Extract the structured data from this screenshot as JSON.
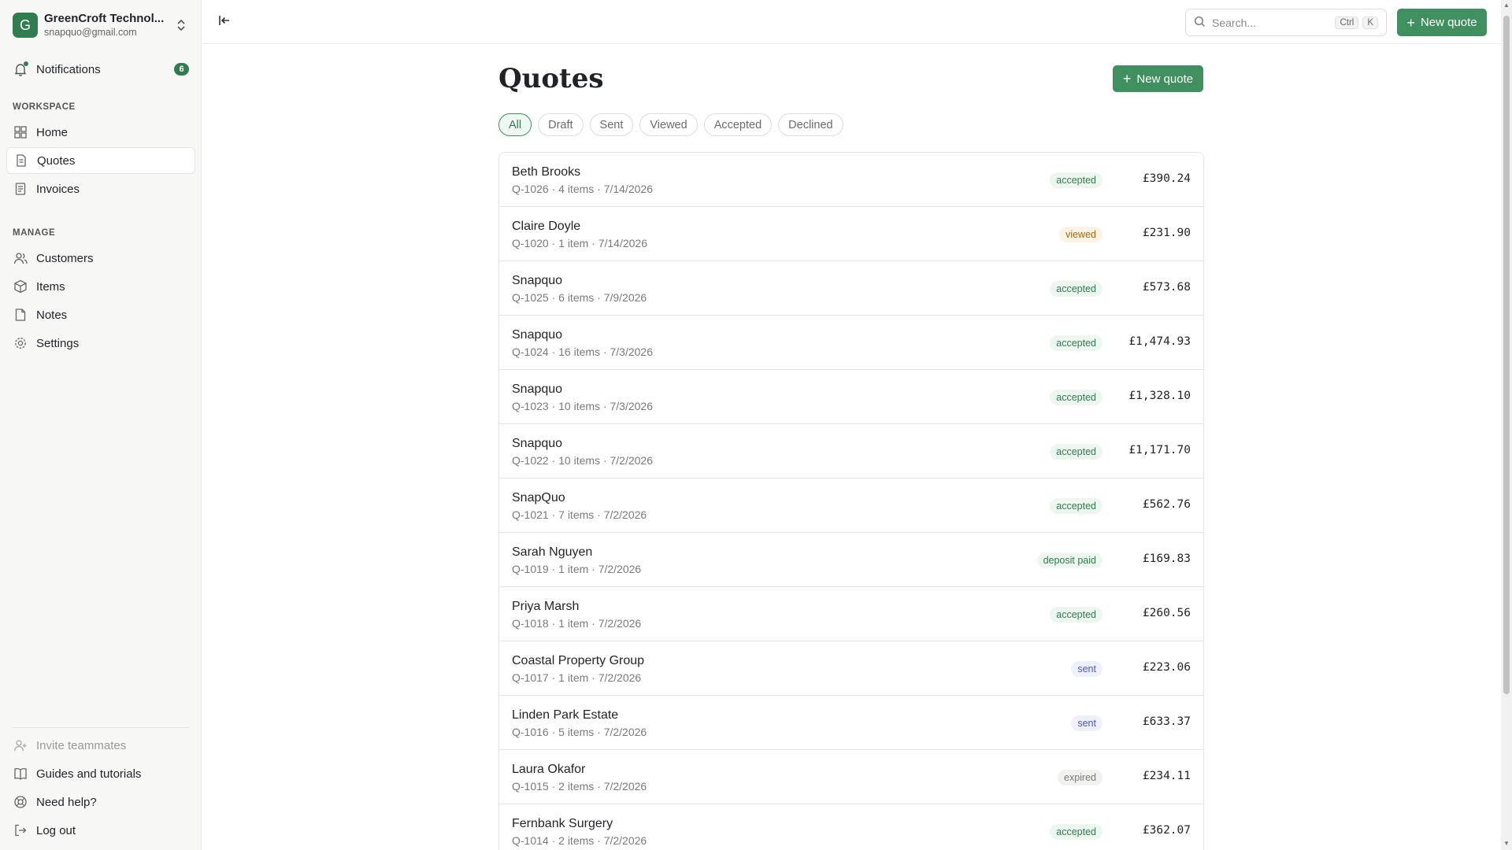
{
  "account": {
    "initial": "G",
    "name": "GreenCroft Technol...",
    "email": "snapquo@gmail.com"
  },
  "notifications": {
    "label": "Notifications",
    "count": "6"
  },
  "sidebar": {
    "workspace_label": "WORKSPACE",
    "workspace_items": [
      {
        "label": "Home",
        "icon": "grid-icon"
      },
      {
        "label": "Quotes",
        "icon": "document-icon"
      },
      {
        "label": "Invoices",
        "icon": "receipt-icon"
      }
    ],
    "manage_label": "MANAGE",
    "manage_items": [
      {
        "label": "Customers",
        "icon": "users-icon"
      },
      {
        "label": "Items",
        "icon": "box-icon"
      },
      {
        "label": "Notes",
        "icon": "note-icon"
      },
      {
        "label": "Settings",
        "icon": "gear-icon"
      }
    ],
    "bottom_items": [
      {
        "label": "Invite teammates",
        "icon": "user-plus-icon"
      },
      {
        "label": "Guides and tutorials",
        "icon": "book-icon"
      },
      {
        "label": "Need help?",
        "icon": "help-icon"
      },
      {
        "label": "Log out",
        "icon": "logout-icon"
      }
    ]
  },
  "topbar": {
    "search_placeholder": "Search...",
    "kbd_ctrl": "Ctrl",
    "kbd_k": "K",
    "new_quote_label": "New quote"
  },
  "main": {
    "title": "Quotes",
    "new_quote_label": "New quote",
    "filters": [
      "All",
      "Draft",
      "Sent",
      "Viewed",
      "Accepted",
      "Declined"
    ],
    "quotes": [
      {
        "name": "Beth Brooks",
        "meta": "Q-1026 · 4 items · 7/14/2026",
        "status": "accepted",
        "amount": "£390.24"
      },
      {
        "name": "Claire Doyle",
        "meta": "Q-1020 · 1 item · 7/14/2026",
        "status": "viewed",
        "amount": "£231.90"
      },
      {
        "name": "Snapquo",
        "meta": "Q-1025 · 6 items · 7/9/2026",
        "status": "accepted",
        "amount": "£573.68"
      },
      {
        "name": "Snapquo",
        "meta": "Q-1024 · 16 items · 7/3/2026",
        "status": "accepted",
        "amount": "£1,474.93"
      },
      {
        "name": "Snapquo",
        "meta": "Q-1023 · 10 items · 7/3/2026",
        "status": "accepted",
        "amount": "£1,328.10"
      },
      {
        "name": "Snapquo",
        "meta": "Q-1022 · 10 items · 7/2/2026",
        "status": "accepted",
        "amount": "£1,171.70"
      },
      {
        "name": "SnapQuo",
        "meta": "Q-1021 · 7 items · 7/2/2026",
        "status": "accepted",
        "amount": "£562.76"
      },
      {
        "name": "Sarah Nguyen",
        "meta": "Q-1019 · 1 item · 7/2/2026",
        "status": "deposit paid",
        "amount": "£169.83"
      },
      {
        "name": "Priya Marsh",
        "meta": "Q-1018 · 1 item · 7/2/2026",
        "status": "accepted",
        "amount": "£260.56"
      },
      {
        "name": "Coastal Property Group",
        "meta": "Q-1017 · 1 item · 7/2/2026",
        "status": "sent",
        "amount": "£223.06"
      },
      {
        "name": "Linden Park Estate",
        "meta": "Q-1016 · 5 items · 7/2/2026",
        "status": "sent",
        "amount": "£633.37"
      },
      {
        "name": "Laura Okafor",
        "meta": "Q-1015 · 2 items · 7/2/2026",
        "status": "expired",
        "amount": "£234.11"
      },
      {
        "name": "Fernbank Surgery",
        "meta": "Q-1014 · 2 items · 7/2/2026",
        "status": "accepted",
        "amount": "£362.07"
      }
    ]
  },
  "colors": {
    "accent": "#3f8f5f",
    "sidebar_bg": "#f7f7f6"
  }
}
